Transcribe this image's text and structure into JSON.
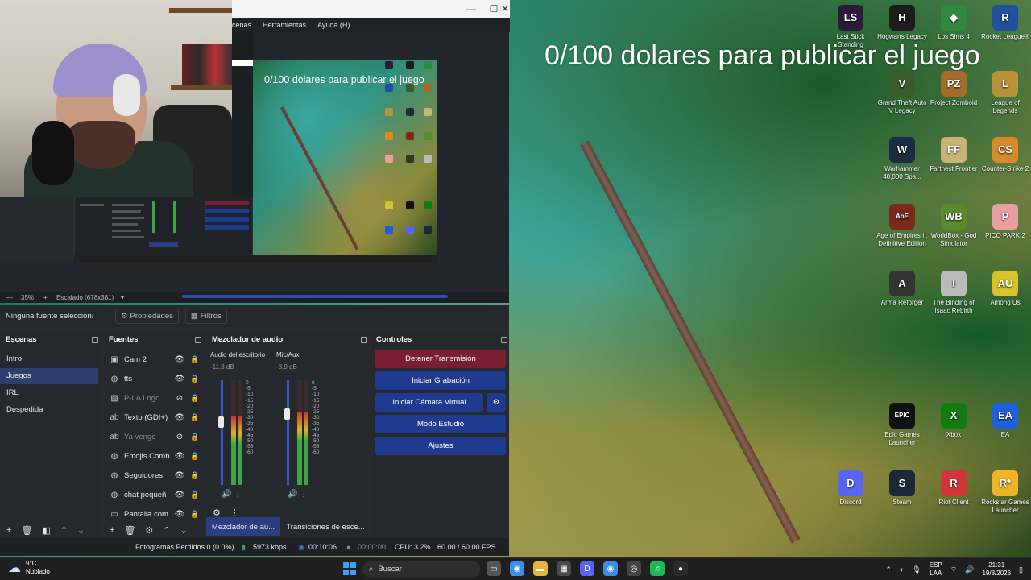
{
  "overlay_text": "0/100 dolares para publicar el juego",
  "obs": {
    "menu": [
      "cenas",
      "Herramientas",
      "Ayuda (H)"
    ],
    "window_controls": {
      "minimize": "—",
      "maximize": "☐",
      "close": "✕"
    },
    "preview_text": "0/100 dolares para publicar el juego",
    "zoom": "35%",
    "scale": "Escalado (678x381)",
    "no_source": "Ninguna fuente seleccionac",
    "properties_label": "Propiedades",
    "filters_label": "Filtros",
    "scenes": {
      "title": "Escenas",
      "items": [
        "Intro",
        "Juegos",
        "IRL",
        "Despedida"
      ],
      "active_index": 1
    },
    "sources": {
      "title": "Fuentes",
      "items": [
        {
          "name": "Cam 2",
          "icon": "camera-icon",
          "visible": true
        },
        {
          "name": "tts",
          "icon": "browser-icon",
          "visible": true
        },
        {
          "name": "P-LA Logo",
          "icon": "image-icon",
          "visible": false
        },
        {
          "name": "Texto (GDI+)",
          "icon": "text-icon",
          "visible": true
        },
        {
          "name": "Ya vengo",
          "icon": "text-icon",
          "visible": false
        },
        {
          "name": "Emojis Comb",
          "icon": "browser-icon",
          "visible": true
        },
        {
          "name": "Seguidores",
          "icon": "browser-icon",
          "visible": true
        },
        {
          "name": "chat pequeñ",
          "icon": "browser-icon",
          "visible": true
        },
        {
          "name": "Pantalla com",
          "icon": "monitor-icon",
          "visible": true
        }
      ]
    },
    "mixer": {
      "title": "Mezclador de audio",
      "channels": [
        {
          "name": "Audio del escritorio",
          "db": "-11.3 dB",
          "level": 0.65,
          "volume": 0.6
        },
        {
          "name": "Mic/Aux",
          "db": "-8.9 dB",
          "level": 0.7,
          "volume": 0.68
        }
      ],
      "ticks": [
        "0",
        "-5",
        "-10",
        "-15",
        "-20",
        "-25",
        "-30",
        "-35",
        "-40",
        "-45",
        "-50",
        "-55",
        "-60"
      ]
    },
    "controls": {
      "title": "Controles",
      "buttons": [
        "Detener Transmisión",
        "Iniciar Grabación",
        "Iniciar Cámara Virtual",
        "Modo Estudio",
        "Ajustes"
      ]
    },
    "bottom_tabs": [
      "Mezclador de au...",
      "Transiciones de esce..."
    ],
    "status": {
      "dropped": "Fotogramas Perdidos 0 (0.0%)",
      "bitrate": "5973 kbps",
      "stream_time": "00:10:06",
      "rec_time": "00:00:00",
      "cpu": "CPU: 3.2%",
      "fps": "60.00 / 60.00 FPS"
    },
    "colors": {
      "accent": "#1f3b8f",
      "stop": "#7a1f33",
      "active_scene": "#2e3f6e"
    }
  },
  "desktop_icons": [
    {
      "label": "Last Stick Standing",
      "color": "#2b1a3a",
      "glyph": "LS"
    },
    {
      "label": "Hogwarts Legacy",
      "color": "#1b1b1b",
      "glyph": "H"
    },
    {
      "label": "Los Sims 4",
      "color": "#2f8a3f",
      "glyph": "◆"
    },
    {
      "label": "Rocket League®",
      "color": "#1f4f9f",
      "glyph": "R"
    },
    {
      "label": "Grand Theft Auto V Legacy",
      "color": "#3a5a2a",
      "glyph": "V"
    },
    {
      "label": "Project Zomboid",
      "color": "#a56a2a",
      "glyph": "PZ"
    },
    {
      "label": "League of Legends",
      "color": "#b8933a",
      "glyph": "L"
    },
    {
      "label": "Warhammer 40,000 Spa...",
      "color": "#1c2b44",
      "glyph": "W"
    },
    {
      "label": "Farthest Frontier",
      "color": "#c9b477",
      "glyph": "FF"
    },
    {
      "label": "Counter-Strike 2",
      "color": "#d98a2a",
      "glyph": "CS"
    },
    {
      "label": "Age of Empires II: Definitive Edition",
      "color": "#7a2a1a",
      "glyph": "AoE"
    },
    {
      "label": "WorldBox - God Simulator",
      "color": "#5a8a2a",
      "glyph": "WB"
    },
    {
      "label": "PICO PARK 2",
      "color": "#e8a0a0",
      "glyph": "P"
    },
    {
      "label": "Arma Reforger",
      "color": "#333333",
      "glyph": "A"
    },
    {
      "label": "The Binding of Isaac Rebirth",
      "color": "#bbbbbb",
      "glyph": "I"
    },
    {
      "label": "Among Us",
      "color": "#d9c22a",
      "glyph": "AU"
    },
    {
      "label": "Epic Games Launcher",
      "color": "#111111",
      "glyph": "EPIC"
    },
    {
      "label": "Xbox",
      "color": "#107c10",
      "glyph": "X"
    },
    {
      "label": "EA",
      "color": "#1f5fd9",
      "glyph": "EA"
    },
    {
      "label": "Discord",
      "color": "#5865f2",
      "glyph": "D"
    },
    {
      "label": "Steam",
      "color": "#1b2838",
      "glyph": "S"
    },
    {
      "label": "Riot Client",
      "color": "#d13639",
      "glyph": "R"
    },
    {
      "label": "Rockstar Games Launcher",
      "color": "#f0b429",
      "glyph": "R*"
    }
  ],
  "taskbar": {
    "weather_temp": "9°C",
    "weather_desc": "Nublado",
    "search_placeholder": "Buscar",
    "apps": [
      {
        "name": "task-view",
        "color": "#555555",
        "glyph": "▭"
      },
      {
        "name": "chrome",
        "color": "#3a8ee6",
        "glyph": "◉"
      },
      {
        "name": "file-explorer",
        "color": "#e6b43a",
        "glyph": "▬"
      },
      {
        "name": "photos",
        "color": "#4a4a4a",
        "glyph": "▦"
      },
      {
        "name": "discord",
        "color": "#5865f2",
        "glyph": "D"
      },
      {
        "name": "chrome-2",
        "color": "#3a8ee6",
        "glyph": "◉"
      },
      {
        "name": "app-circle",
        "color": "#444444",
        "glyph": "◎"
      },
      {
        "name": "spotify",
        "color": "#1db954",
        "glyph": "♫"
      },
      {
        "name": "obs",
        "color": "#2a2a2a",
        "glyph": "●"
      }
    ],
    "lang": "ESP",
    "region": "LAA",
    "time": "21:31",
    "date": "19/8/2026"
  }
}
